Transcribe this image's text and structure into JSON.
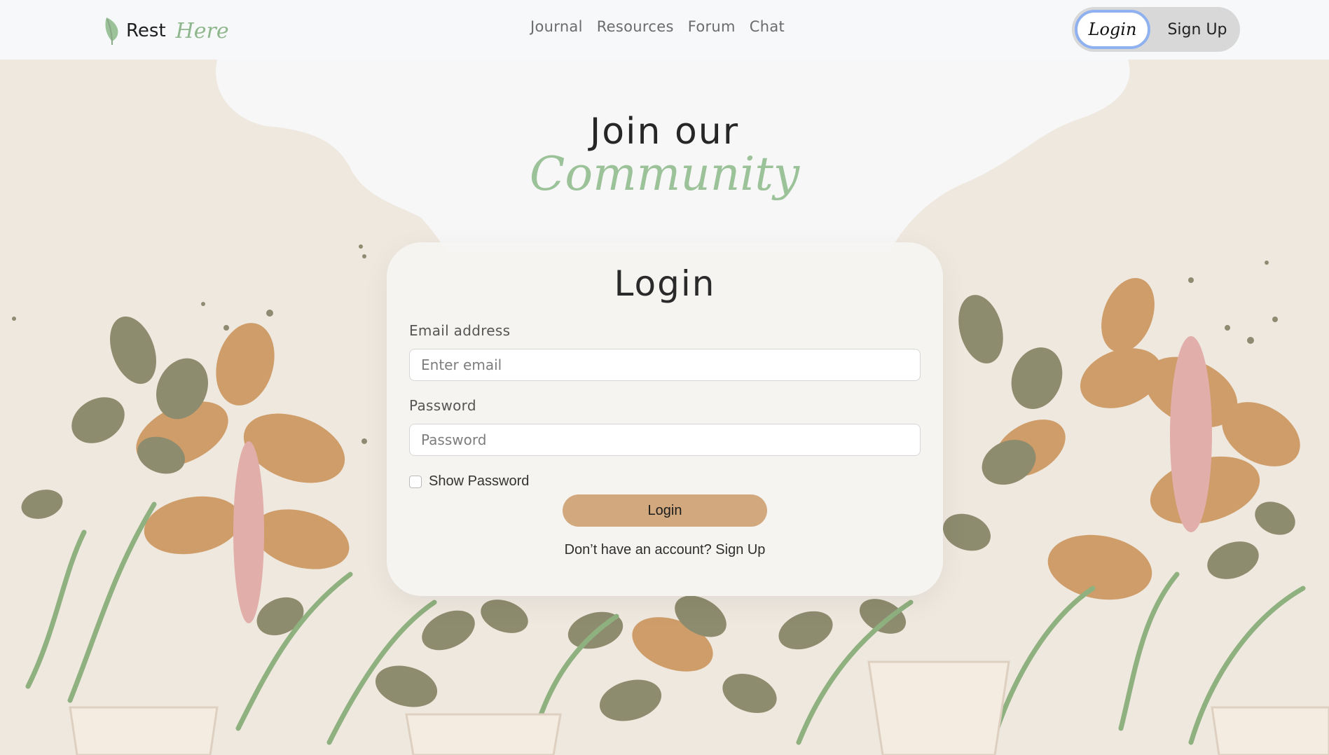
{
  "brand": {
    "name_part1": "Rest",
    "name_part2": "Here",
    "icon": "leaf-icon"
  },
  "nav": {
    "links": [
      "Journal",
      "Resources",
      "Forum",
      "Chat"
    ]
  },
  "auth": {
    "login_label": "Login",
    "signup_label": "Sign Up"
  },
  "hero": {
    "line1": "Join our",
    "line2": "Community"
  },
  "form": {
    "title": "Login",
    "email_label": "Email address",
    "email_placeholder": "Enter email",
    "email_value": "",
    "password_label": "Password",
    "password_placeholder": "Password",
    "password_value": "",
    "show_password_label": "Show Password",
    "show_password_checked": false,
    "submit_label": "Login",
    "signup_prompt": "Don’t have an account?",
    "signup_link": "Sign Up"
  },
  "colors": {
    "accent_green": "#9cc29a",
    "button_tan": "#d2a87e",
    "background": "#efe8df",
    "focus_ring": "#8fb1f0"
  }
}
